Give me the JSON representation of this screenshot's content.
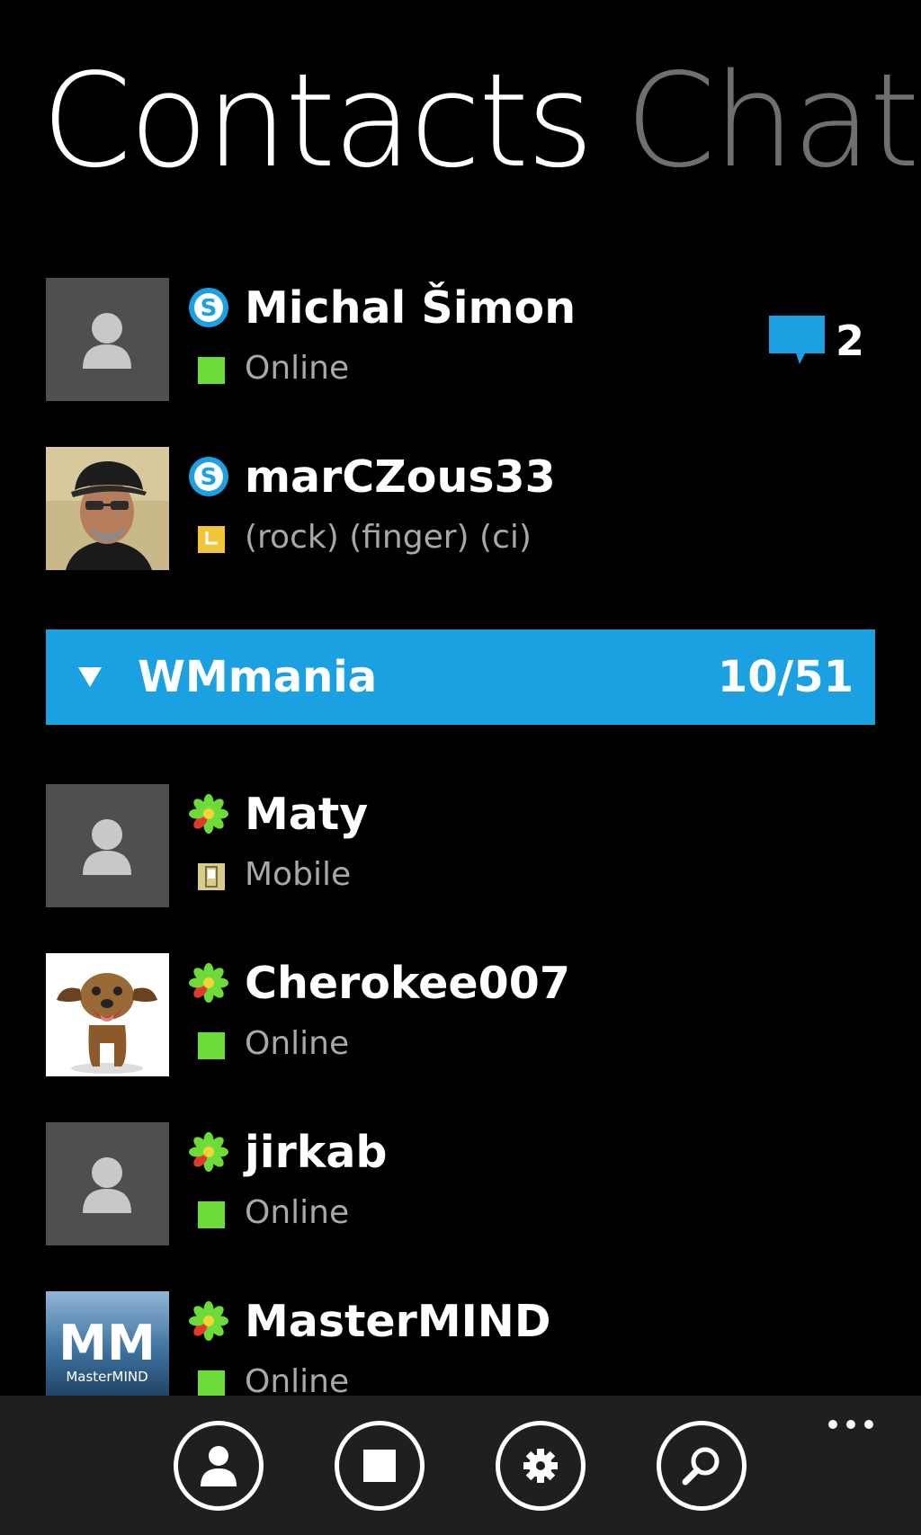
{
  "pivot": {
    "tabs": [
      {
        "label": "Contacts",
        "active": true
      },
      {
        "label": "Chats",
        "active": false
      }
    ]
  },
  "contacts_top": [
    {
      "name": "Michal Šimon",
      "status": "Online",
      "protocol": "skype",
      "status_type": "online",
      "avatar": "placeholder",
      "unread": "2"
    },
    {
      "name": "marCZous33",
      "status": "(rock) (finger) (ci)",
      "protocol": "skype",
      "status_type": "away",
      "avatar": "photo-man-cap"
    }
  ],
  "group": {
    "name": "WMmania",
    "count": "10/51",
    "color": "#1ba1e2"
  },
  "contacts_group": [
    {
      "name": "Maty",
      "status": "Mobile",
      "protocol": "icq",
      "status_type": "mobile",
      "avatar": "placeholder"
    },
    {
      "name": "Cherokee007",
      "status": "Online",
      "protocol": "icq",
      "status_type": "online",
      "avatar": "photo-dog"
    },
    {
      "name": "jirkab",
      "status": "Online",
      "protocol": "icq",
      "status_type": "online",
      "avatar": "placeholder"
    },
    {
      "name": "MasterMIND",
      "status": "Online",
      "protocol": "icq",
      "status_type": "online",
      "avatar": "logo-mastermind",
      "avatar_text_big": "MM",
      "avatar_text_small": "MasterMIND"
    }
  ],
  "app_bar": {
    "buttons": [
      "add-contact-icon",
      "status-icon",
      "settings-icon",
      "search-icon"
    ],
    "more": "more-icon"
  },
  "colors": {
    "online": "#6ddc3a",
    "away": "#f0c53a",
    "mobile": "#d8cc8a",
    "skype": "#1ba1e2",
    "accent": "#1ba1e2"
  }
}
